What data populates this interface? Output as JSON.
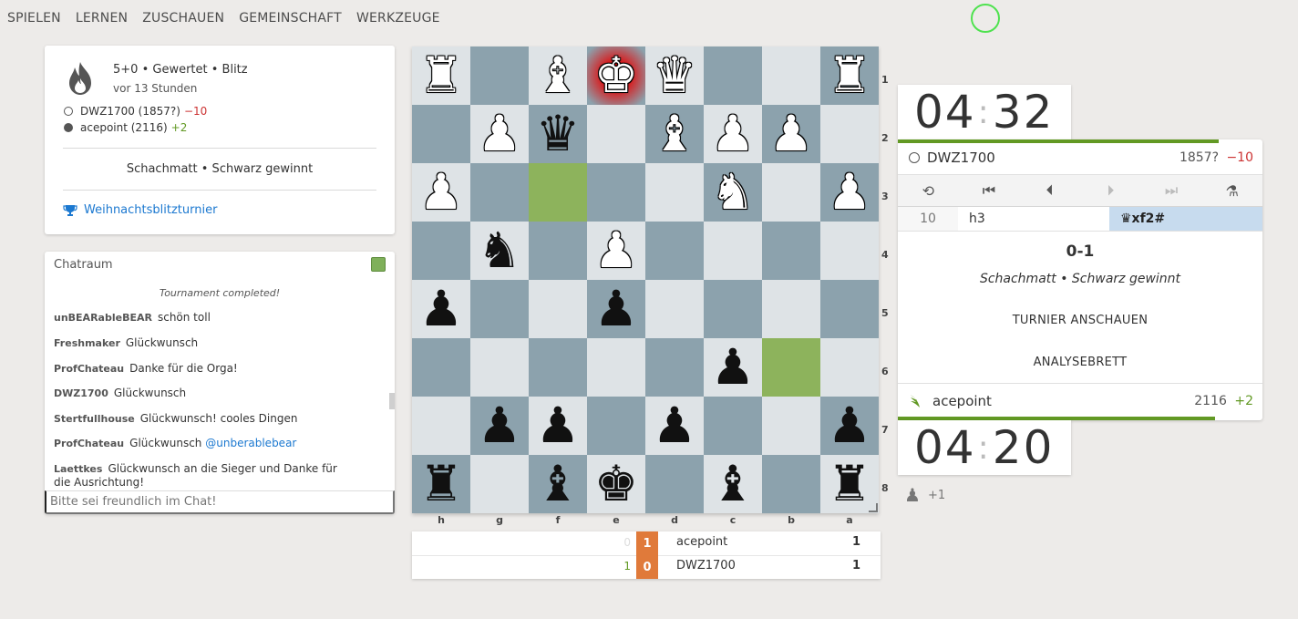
{
  "nav": [
    "SPIELEN",
    "LERNEN",
    "ZUSCHAUEN",
    "GEMEINSCHAFT",
    "WERKZEUGE"
  ],
  "game_info": {
    "setup": "5+0 • Gewertet • Blitz",
    "time_ago": "vor 13 Stunden",
    "white_player": "DWZ1700 (1857?)",
    "white_diff": "−10",
    "black_player": "acepoint (2116)",
    "black_diff": "+2",
    "status": "Schachmatt • Schwarz gewinnt",
    "tournament": "Weihnachtsblitzturnier",
    "icon": "flame-icon"
  },
  "chat": {
    "title": "Chatraum",
    "system": "Tournament completed!",
    "messages": [
      {
        "user": "unBEARableBEAR",
        "text": "schön toll"
      },
      {
        "user": "Freshmaker",
        "text": "Glückwunsch"
      },
      {
        "user": "ProfChateau",
        "text": "Danke für die Orga!"
      },
      {
        "user": "DWZ1700",
        "text": "Glückwunsch"
      },
      {
        "user": "Stertfullhouse",
        "text": "Glückwunsch! cooles Dingen"
      },
      {
        "user": "ProfChateau",
        "text": "Glückwunsch",
        "mention": "@unberablebear"
      },
      {
        "user": "Laettkes",
        "text": "Glückwunsch an die Sieger und Danke für die Ausrichtung!"
      }
    ],
    "placeholder": "Bitte sei freundlich im Chat!"
  },
  "board": {
    "orientation": "black",
    "ranks": [
      "1",
      "2",
      "3",
      "4",
      "5",
      "6",
      "7",
      "8"
    ],
    "files": [
      "h",
      "g",
      "f",
      "e",
      "d",
      "c",
      "b",
      "a"
    ],
    "rows": [
      [
        "wR",
        "",
        "wB",
        "wK",
        "wQ",
        "",
        "",
        "wR"
      ],
      [
        "",
        "wP",
        "bQ",
        "",
        "wB",
        "wP",
        "wP",
        ""
      ],
      [
        "wP",
        "",
        "",
        "",
        "",
        "wN",
        "",
        "wP"
      ],
      [
        "",
        "bN",
        "",
        "wP",
        "",
        "",
        "",
        ""
      ],
      [
        "bP",
        "",
        "",
        "bP",
        "",
        "",
        "",
        ""
      ],
      [
        "",
        "",
        "",
        "",
        "",
        "bP",
        "",
        ""
      ],
      [
        "",
        "bP",
        "bP",
        "",
        "bP",
        "",
        "",
        "bP"
      ],
      [
        "bR",
        "",
        "bB",
        "bK",
        "",
        "bB",
        "",
        "bR"
      ]
    ],
    "highlight": [
      "2-2",
      "5-6"
    ],
    "check": "0-3",
    "colors": {
      "light": "#dee3e6",
      "dark": "#8ca2ad",
      "highlight": "#8db35c"
    }
  },
  "crosstable": [
    {
      "left": "0",
      "mid": "1",
      "name": "acepoint",
      "score": "1"
    },
    {
      "left": "1",
      "mid": "0",
      "name": "DWZ1700",
      "score": "1"
    }
  ],
  "clock_top": {
    "min": "04",
    "sec": "32"
  },
  "clock_bottom": {
    "min": "04",
    "sec": "20"
  },
  "top_player": {
    "name": "DWZ1700",
    "rating": "1857?",
    "diff": "−10",
    "time_fraction": 0.88
  },
  "bottom_player": {
    "name": "acepoint",
    "rating": "2116",
    "diff": "+2",
    "time_fraction": 0.87
  },
  "moves": {
    "number": "10",
    "white": "h3",
    "black": "♛xf2#"
  },
  "result": {
    "score": "0-1",
    "text": "Schachmatt • Schwarz gewinnt"
  },
  "buttons": {
    "watch_tournament": "TURNIER ANSCHAUEN",
    "analysis": "ANALYSEBRETT"
  },
  "spectators": "+1"
}
